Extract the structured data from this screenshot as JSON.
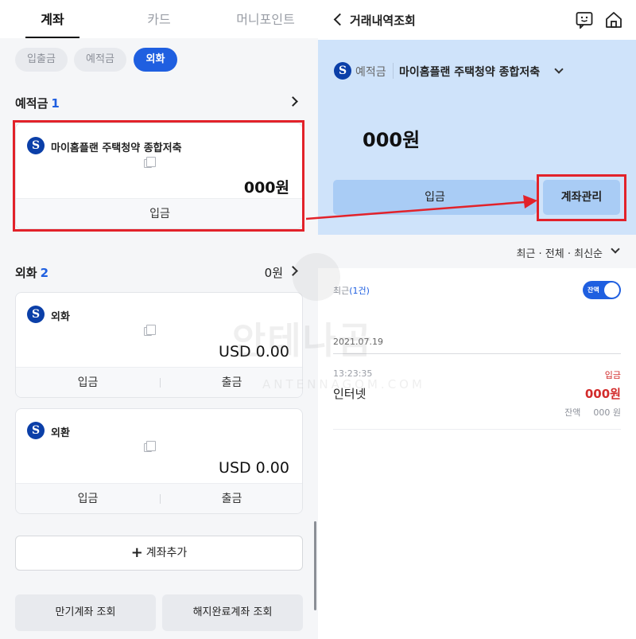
{
  "left": {
    "tabs": [
      {
        "label": "계좌",
        "active": true
      },
      {
        "label": "카드",
        "active": false
      },
      {
        "label": "머니포인트",
        "active": false
      }
    ],
    "filters": [
      {
        "label": "입출금",
        "active": false
      },
      {
        "label": "예적금",
        "active": false
      },
      {
        "label": "외화",
        "active": true
      }
    ],
    "savings_section": {
      "title": "예적금",
      "count": "1"
    },
    "savings_card": {
      "logo": "S",
      "name": "마이홈플랜 주택청약 종합저축",
      "amount": "000원",
      "action": "입금"
    },
    "fx_section": {
      "title": "외화",
      "count": "2",
      "total": "0원"
    },
    "fx_cards": [
      {
        "logo": "S",
        "name": "외화",
        "amount": "USD 0.00",
        "action1": "입금",
        "action2": "출금"
      },
      {
        "logo": "S",
        "name": "외환",
        "amount": "USD 0.00",
        "action1": "입금",
        "action2": "출금"
      }
    ],
    "add_account": {
      "plus": "+",
      "label": "계좌추가"
    },
    "bottom_buttons": [
      {
        "label": "만기계좌 조회"
      },
      {
        "label": "해지완료계좌 조회"
      }
    ]
  },
  "right": {
    "title": "거래내역조회",
    "account": {
      "logo": "S",
      "type": "예적금",
      "name": "마이홈플랜 주택청약 종합저축"
    },
    "balance": "000원",
    "deposit_button": "입금",
    "manage_button": "계좌관리",
    "filter_label": "최근 · 전체 · 최신순",
    "recent": {
      "label": "최근",
      "count": "(1건)"
    },
    "toggle": {
      "label": "잔액",
      "on": true
    },
    "transaction": {
      "date": "2021.07.19",
      "time": "13:23:35",
      "type": "입금",
      "description": "인터넷",
      "amount": "000원",
      "balance_label": "잔액",
      "balance_value": "000 원"
    }
  },
  "watermark": {
    "text": "안테나곰",
    "sub": "ANTENNAGOM.COM"
  },
  "icons": [
    "bank-logo-icon",
    "copy-icon",
    "chevron-right-icon",
    "chevron-left-icon",
    "chevron-down-icon",
    "chatbot-icon",
    "home-icon",
    "plus-icon"
  ],
  "colors": {
    "accent": "#1f5fe0",
    "highlight": "#e2222a",
    "hero_bg": "#cfe3fa",
    "button_bg": "#a9ccf5",
    "deposit_red": "#d22b2b",
    "bank_logo": "#0b3fa8"
  }
}
